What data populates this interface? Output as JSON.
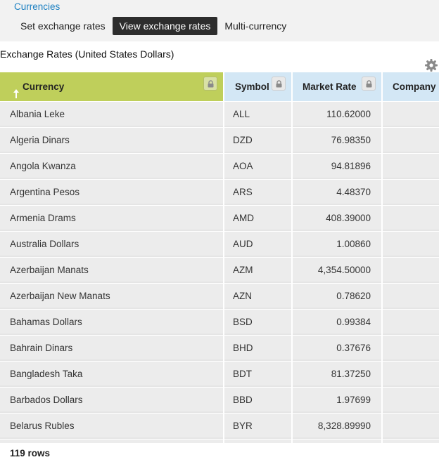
{
  "breadcrumb": "Currencies",
  "tabs": [
    {
      "label": "Set exchange rates",
      "active": false
    },
    {
      "label": "View exchange rates",
      "active": true
    },
    {
      "label": "Multi-currency",
      "active": false
    }
  ],
  "page_title": "Exchange Rates (United States Dollars)",
  "icons": {
    "settings": "gear-icon",
    "lock": "lock-icon",
    "sort": "sort-ascending-icon"
  },
  "columns": {
    "currency": "Currency",
    "symbol": "Symbol",
    "market_rate": "Market Rate",
    "company": "Company"
  },
  "rows": [
    {
      "currency": "Albania Leke",
      "symbol": "ALL",
      "market_rate": "110.62000"
    },
    {
      "currency": "Algeria Dinars",
      "symbol": "DZD",
      "market_rate": "76.98350"
    },
    {
      "currency": "Angola Kwanza",
      "symbol": "AOA",
      "market_rate": "94.81896"
    },
    {
      "currency": "Argentina Pesos",
      "symbol": "ARS",
      "market_rate": "4.48370"
    },
    {
      "currency": "Armenia Drams",
      "symbol": "AMD",
      "market_rate": "408.39000"
    },
    {
      "currency": "Australia Dollars",
      "symbol": "AUD",
      "market_rate": "1.00860"
    },
    {
      "currency": "Azerbaijan Manats",
      "symbol": "AZM",
      "market_rate": "4,354.50000"
    },
    {
      "currency": "Azerbaijan New Manats",
      "symbol": "AZN",
      "market_rate": "0.78620"
    },
    {
      "currency": "Bahamas Dollars",
      "symbol": "BSD",
      "market_rate": "0.99384"
    },
    {
      "currency": "Bahrain Dinars",
      "symbol": "BHD",
      "market_rate": "0.37676"
    },
    {
      "currency": "Bangladesh Taka",
      "symbol": "BDT",
      "market_rate": "81.37250"
    },
    {
      "currency": "Barbados Dollars",
      "symbol": "BBD",
      "market_rate": "1.97699"
    },
    {
      "currency": "Belarus Rubles",
      "symbol": "BYR",
      "market_rate": "8,328.89990"
    }
  ],
  "footer": "119 rows",
  "colors": {
    "accent_link": "#1a7fc1",
    "sorted_header": "#bfcf5b",
    "header": "#d3e7f5",
    "active_tab": "#2d2d2d"
  }
}
